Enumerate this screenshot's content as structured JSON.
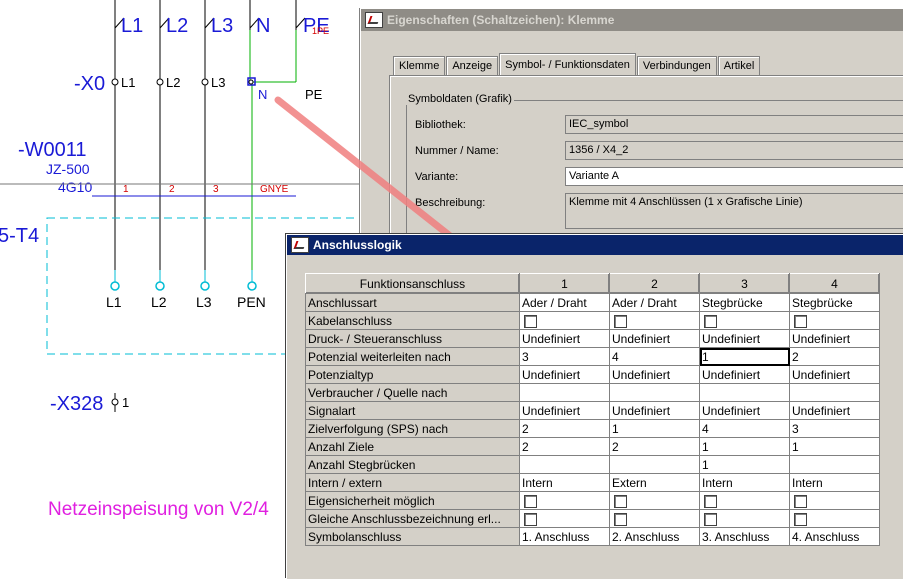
{
  "cad": {
    "phases": [
      "L1",
      "L2",
      "L3",
      "N",
      "PE"
    ],
    "pe_sub": "1PE",
    "terminal_x0": "-X0",
    "x0_labels": [
      "L1",
      "L2",
      "L3"
    ],
    "x0_n": "N",
    "x0_pe": "PE",
    "cable_name": "-W0011",
    "cable_type": "JZ-500",
    "cable_cores": "4G10",
    "core_numbers": [
      "1",
      "2",
      "3"
    ],
    "core_gnye": "GNYE",
    "device": "5-T4",
    "bottom_labels": [
      "L1",
      "L2",
      "L3",
      "PEN"
    ],
    "terminal_x328": "-X328",
    "x328_pin": "1",
    "caption": "Netzeinspeisung von V2/4"
  },
  "props_window": {
    "title": "Eigenschaften (Schaltzeichen): Klemme",
    "tabs": [
      "Klemme",
      "Anzeige",
      "Symbol- / Funktionsdaten",
      "Verbindungen",
      "Artikel"
    ],
    "group_label": "Symboldaten (Grafik)",
    "fields": [
      {
        "label": "Bibliothek:",
        "value": "IEC_symbol"
      },
      {
        "label": "Nummer / Name:",
        "value": "1356 / X4_2"
      },
      {
        "label": "Variante:",
        "value": "Variante A"
      },
      {
        "label": "Beschreibung:",
        "value": "Klemme mit 4 Anschlüssen (1 x Grafische Linie)"
      }
    ]
  },
  "logic_window": {
    "title": "Anschlusslogik",
    "header": [
      "Funktionsanschluss",
      "1",
      "2",
      "3",
      "4"
    ],
    "rows": [
      {
        "label": "Anschlussart",
        "cells": [
          "Ader / Draht",
          "Ader / Draht",
          "Stegbrücke",
          "Stegbrücke"
        ]
      },
      {
        "label": "Kabelanschluss",
        "cells": [
          "[ ]",
          "[ ]",
          "[ ]",
          "[ ]"
        ]
      },
      {
        "label": "Druck- / Steueranschluss",
        "cells": [
          "Undefiniert",
          "Undefiniert",
          "Undefiniert",
          "Undefiniert"
        ]
      },
      {
        "label": "Potenzial weiterleiten nach",
        "cells": [
          "3",
          "4",
          "1",
          "2"
        ]
      },
      {
        "label": "Potenzialtyp",
        "cells": [
          "Undefiniert",
          "Undefiniert",
          "Undefiniert",
          "Undefiniert"
        ]
      },
      {
        "label": "Verbraucher / Quelle nach",
        "cells": [
          "",
          "",
          "",
          ""
        ]
      },
      {
        "label": "Signalart",
        "cells": [
          "Undefiniert",
          "Undefiniert",
          "Undefiniert",
          "Undefiniert"
        ]
      },
      {
        "label": "Zielverfolgung (SPS) nach",
        "cells": [
          "2",
          "1",
          "4",
          "3"
        ]
      },
      {
        "label": "Anzahl Ziele",
        "cells": [
          "2",
          "2",
          "1",
          "1"
        ]
      },
      {
        "label": "Anzahl Stegbrücken",
        "cells": [
          "",
          "",
          "1",
          ""
        ]
      },
      {
        "label": "Intern / extern",
        "cells": [
          "Intern",
          "Extern",
          "Intern",
          "Intern"
        ]
      },
      {
        "label": "Eigensicherheit möglich",
        "cells": [
          "[ ]",
          "[ ]",
          "[ ]",
          "[ ]"
        ]
      },
      {
        "label": "Gleiche Anschlussbezeichnung erl...",
        "cells": [
          "[ ]",
          "[ ]",
          "[ ]",
          "[ ]"
        ]
      },
      {
        "label": "Symbolanschluss",
        "cells": [
          "1. Anschluss",
          "2. Anschluss",
          "3. Anschluss",
          "4. Anschluss"
        ]
      }
    ]
  },
  "colors": {
    "cad_blue": "#1a1ad6",
    "cad_cyan": "#00bcd4",
    "cad_red": "#d40000",
    "cad_magenta": "#e020e0",
    "title_active": "#0a246a",
    "title_inactive": "#8f8c86"
  }
}
